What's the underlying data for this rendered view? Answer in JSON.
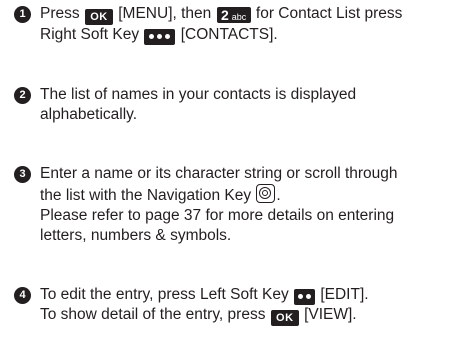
{
  "steps": [
    {
      "number": "1",
      "line1": {
        "press": "Press",
        "menu": "[MENU], then",
        "for": "for Contact List press"
      },
      "line2": {
        "rsk": "Right Soft Key",
        "contacts": "[CONTACTS]."
      }
    },
    {
      "number": "2",
      "line1": "The list of names in your contacts is displayed",
      "line2": "alphabetically."
    },
    {
      "number": "3",
      "line1": "Enter a name or its character string or scroll through",
      "line2": "the list with the Navigation Key",
      "line2_end": ".",
      "line3": "Please refer to page 37 for more details on entering",
      "line4": "letters, numbers & symbols."
    },
    {
      "number": "4",
      "line1": {
        "pre": "To edit the entry, press Left Soft Key",
        "edit": "[EDIT]."
      },
      "line2": {
        "pre": "To show detail of the entry, press",
        "view": "[VIEW]."
      }
    }
  ],
  "keys": {
    "ok": "OK",
    "two_digit": "2",
    "two_letters": "abc"
  },
  "icons": {
    "ok_key": "ok-key-icon",
    "two_key": "two-abc-key-icon",
    "right_soft_key": "three-dot-soft-key-icon",
    "left_soft_key": "two-dot-soft-key-icon",
    "navigation_key": "navigation-key-icon"
  },
  "colors": {
    "text": "#231f20",
    "key_fill": "#231f20",
    "key_text": "#ffffff"
  }
}
